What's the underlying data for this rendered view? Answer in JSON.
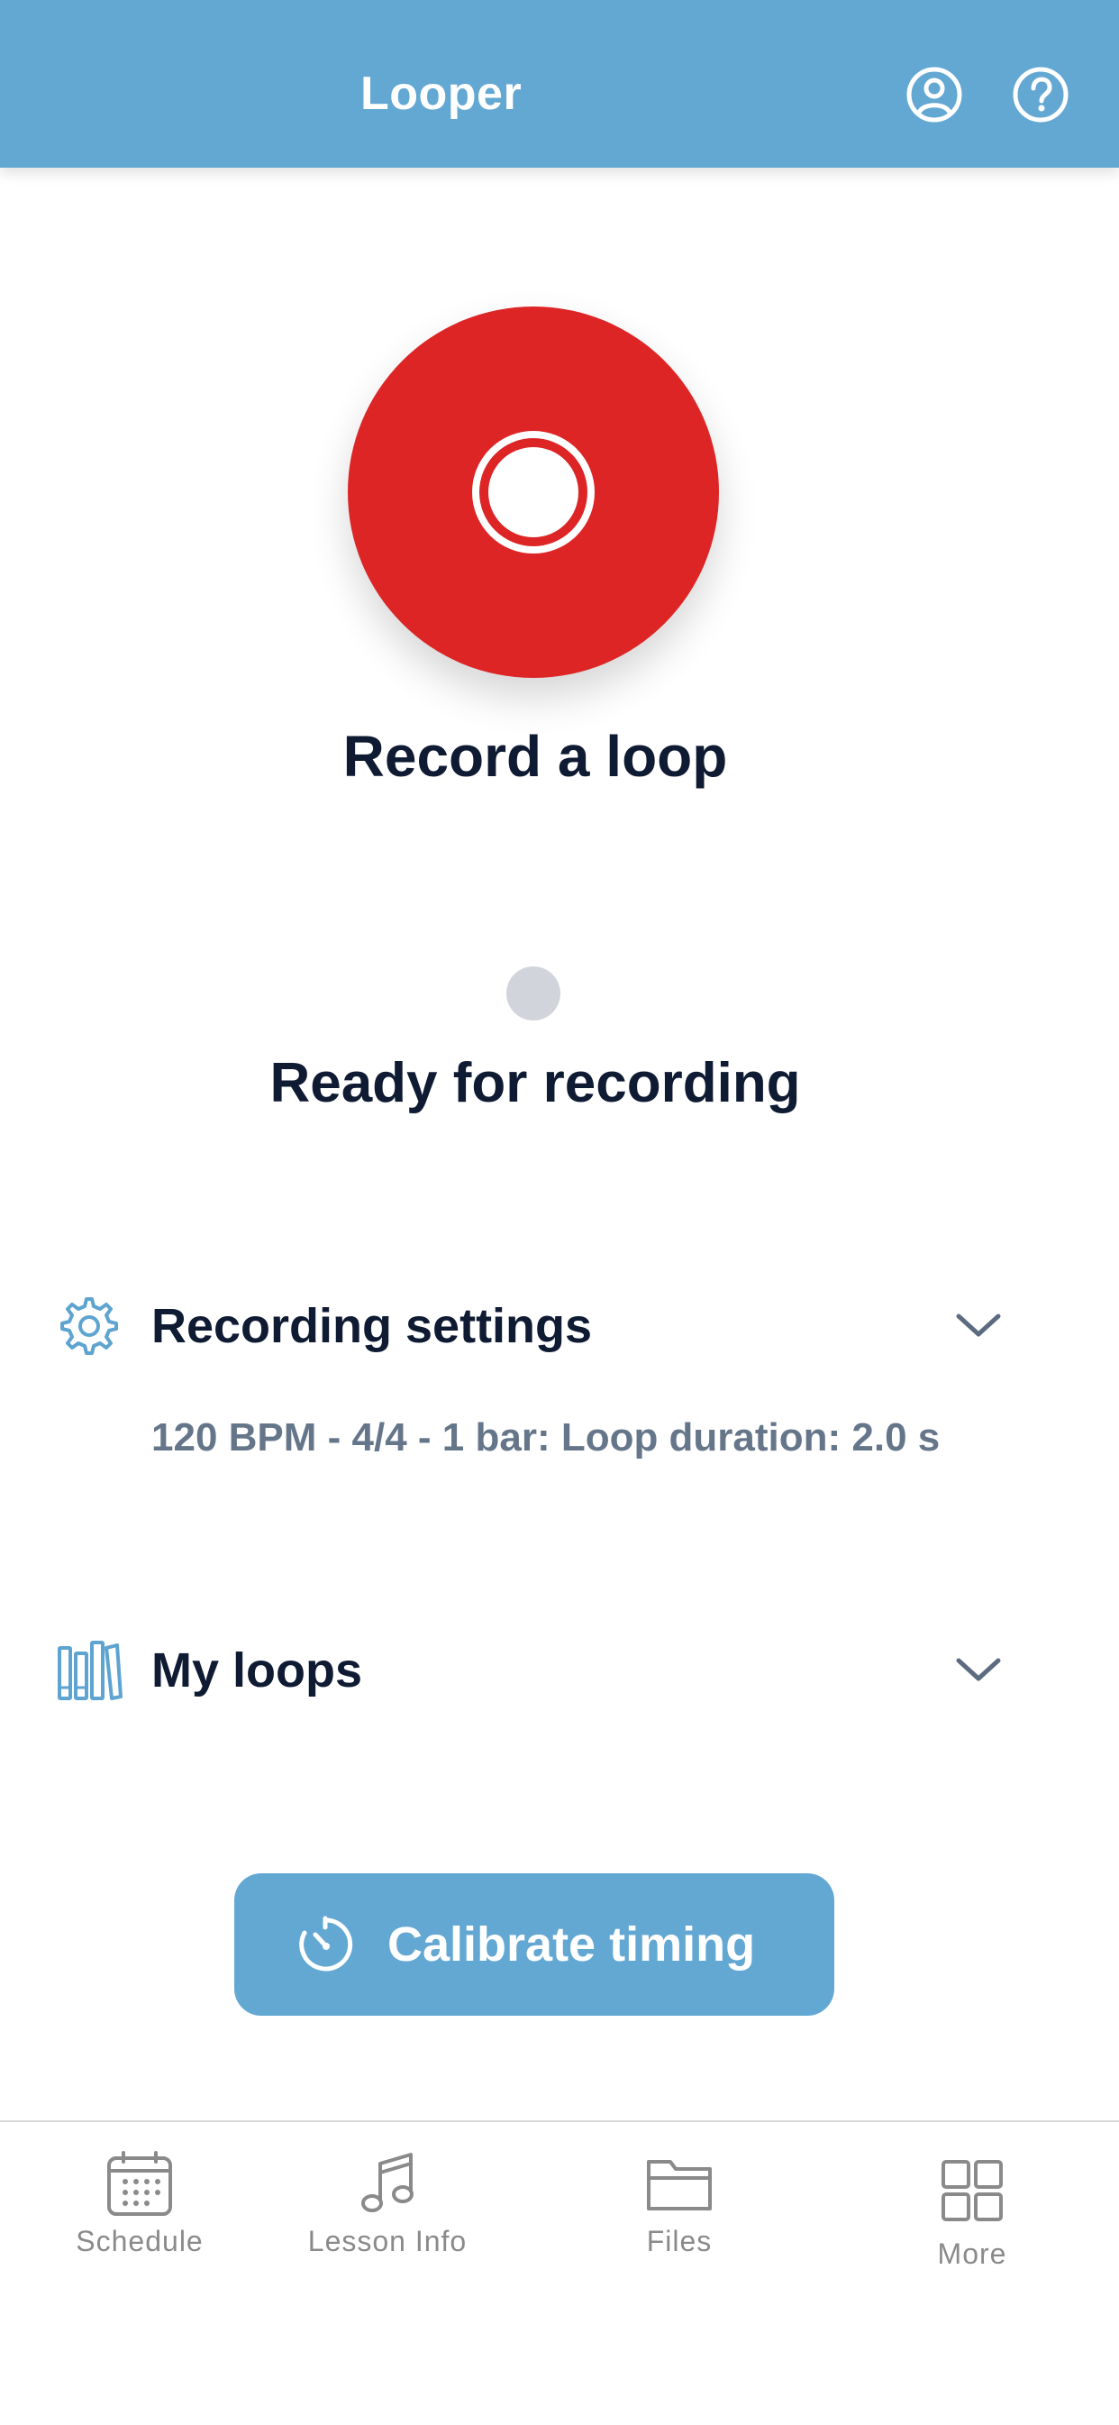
{
  "header": {
    "title": "Looper",
    "background": "#63a8d3",
    "icons": [
      "account-icon",
      "help-icon"
    ]
  },
  "record": {
    "button_color": "#dd2526",
    "label": "Record a loop"
  },
  "status": {
    "text": "Ready for recording",
    "indicator_color": "#d1d5db"
  },
  "sections": {
    "settings": {
      "title": "Recording settings",
      "summary": "120 BPM - 4/4 - 1 bar: Loop duration: 2.0 s",
      "icon": "gear-icon"
    },
    "loops": {
      "title": "My loops",
      "icon": "library-icon"
    }
  },
  "calibrate": {
    "label": "Calibrate timing",
    "icon": "timer-icon"
  },
  "tabs": [
    {
      "label": "Schedule",
      "icon": "calendar-icon"
    },
    {
      "label": "Lesson Info",
      "icon": "music-note-icon"
    },
    {
      "label": "Files",
      "icon": "folder-icon"
    },
    {
      "label": "More",
      "icon": "grid-icon"
    }
  ]
}
